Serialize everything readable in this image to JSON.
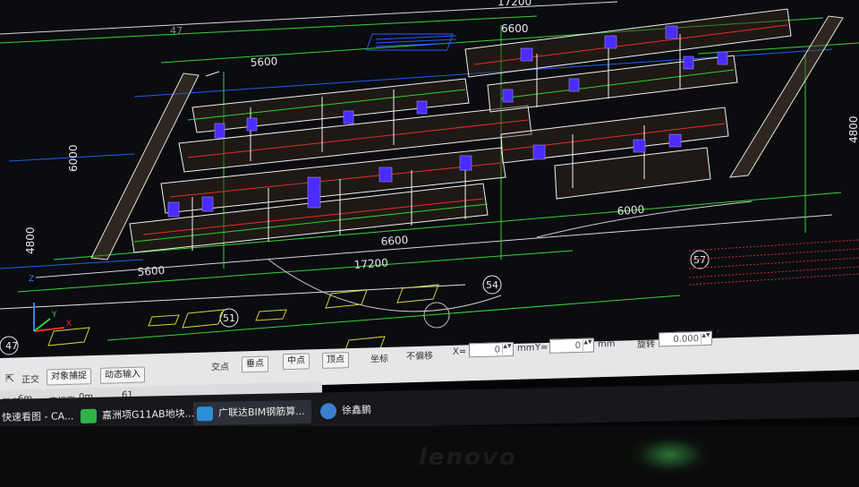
{
  "drawing": {
    "dimensions": {
      "d_17200_top": "17200",
      "d_47": "47",
      "d_6600_top": "6600",
      "d_5600_top": "5600",
      "d_6000_left": "6000",
      "d_4800_right": "4800",
      "d_4800_left": "4800",
      "d_6600_bottom": "6600",
      "d_5600_bottom": "5600",
      "d_17200_bottom": "17200",
      "d_6000_bottom": "6000"
    },
    "axis_markers": [
      "57",
      "54",
      "51",
      "47"
    ],
    "ucs": {
      "x": "X",
      "y": "Y",
      "z": "Z"
    }
  },
  "status_bar": {
    "cancel_icon": "⇱",
    "ortho": "正交",
    "object_snap": "对象捕捉",
    "dynamic_input": "动态输入",
    "intersection": "交点",
    "perpendicular": "垂点",
    "midpoint": "中点",
    "vertex": "顶点",
    "coordinate": "坐标",
    "offset_mode": "不偏移",
    "x_label": "X=",
    "x_value": "0",
    "x_unit": "mm",
    "y_label": "Y=",
    "y_value": "0",
    "y_unit": "mm",
    "rotate_label": "旋转",
    "rotate_value": "0.000",
    "degree": "°"
  },
  "info_bar": {
    "floor_height_label": "层高:",
    "floor_height_value": "6m",
    "base_height_label": "底标高:",
    "base_height_value": "0m",
    "extra_value": "61"
  },
  "taskbar": {
    "items": [
      {
        "label": "快速看图 - CA...",
        "color": "#d04030"
      },
      {
        "label": "嘉洲项G11AB地块...",
        "color": "#2fb24a"
      },
      {
        "label": "广联达BIM钢筋算...",
        "color": "#2b8fd8"
      },
      {
        "label": "徐鑫鹏",
        "color": "#3a7fd0"
      }
    ]
  },
  "monitor": {
    "brand": "lenovo"
  }
}
